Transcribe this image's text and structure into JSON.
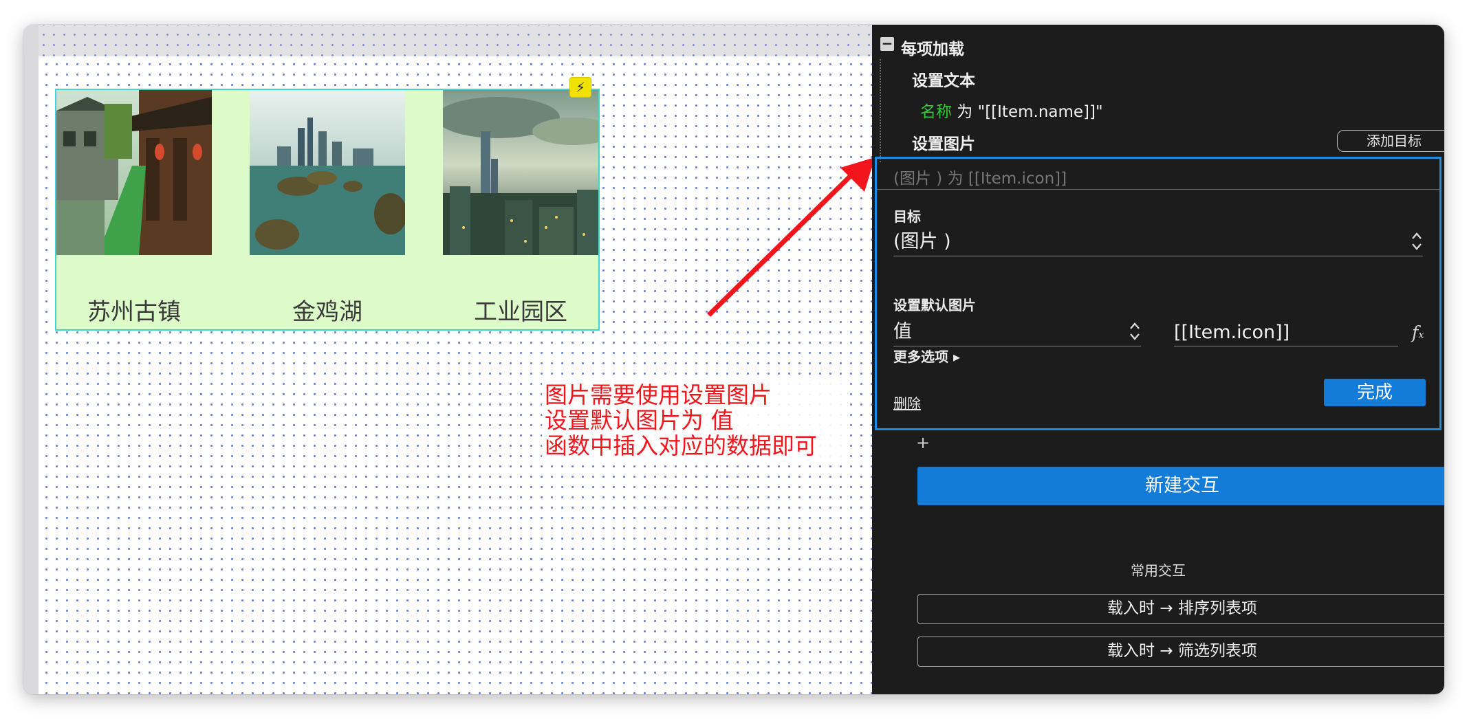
{
  "canvas": {
    "repeater_items": [
      {
        "name": "苏州古镇",
        "image": "water-town-photo"
      },
      {
        "name": "金鸡湖",
        "image": "lake-skyline-photo"
      },
      {
        "name": "工业园区",
        "image": "city-skyline-photo"
      }
    ],
    "badge_icon": "lightning-icon",
    "annotation_text": "图片需要使用设置图片\n设置默认图片为  值\n函数中插入对应的数据即可"
  },
  "panel": {
    "event_title": "每项加载",
    "collapse_symbol": "−",
    "action_set_text": "设置文本",
    "set_text_line": {
      "target": "名称",
      "rest": " 为 \"[[Item.name]]\""
    },
    "action_set_image": "设置图片",
    "add_target_label": "添加目标",
    "editor": {
      "summary": "(图片 ) 为 [[Item.icon]]",
      "target_label": "目标",
      "target_value": "(图片 )",
      "default_image_label": "设置默认图片",
      "default_mode_value": "值",
      "default_expr_value": "[[Item.icon]]",
      "fx_icon": "function-icon",
      "more_options_label": "更多选项 ▸",
      "delete_label": "删除",
      "done_label": "完成"
    },
    "plus_symbol": "+",
    "new_interaction_label": "新建交互",
    "common_title": "常用交互",
    "common_items": [
      "载入时 → 排序列表项",
      "载入时 → 筛选列表项"
    ],
    "colors": {
      "accent": "#137bd8",
      "keyword_green": "#35c83b",
      "editor_border": "#1d8ce6"
    }
  }
}
